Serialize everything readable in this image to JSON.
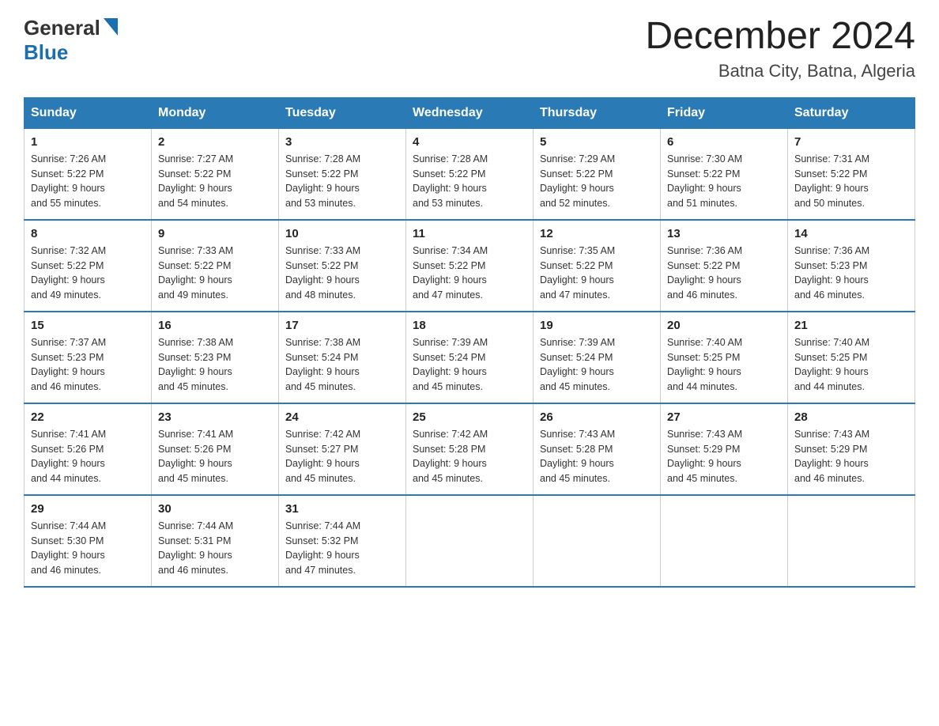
{
  "header": {
    "logo_general": "General",
    "logo_blue": "Blue",
    "month_title": "December 2024",
    "location": "Batna City, Batna, Algeria"
  },
  "days_header": [
    "Sunday",
    "Monday",
    "Tuesday",
    "Wednesday",
    "Thursday",
    "Friday",
    "Saturday"
  ],
  "weeks": [
    [
      {
        "day": "1",
        "sunrise": "7:26 AM",
        "sunset": "5:22 PM",
        "daylight": "9 hours and 55 minutes."
      },
      {
        "day": "2",
        "sunrise": "7:27 AM",
        "sunset": "5:22 PM",
        "daylight": "9 hours and 54 minutes."
      },
      {
        "day": "3",
        "sunrise": "7:28 AM",
        "sunset": "5:22 PM",
        "daylight": "9 hours and 53 minutes."
      },
      {
        "day": "4",
        "sunrise": "7:28 AM",
        "sunset": "5:22 PM",
        "daylight": "9 hours and 53 minutes."
      },
      {
        "day": "5",
        "sunrise": "7:29 AM",
        "sunset": "5:22 PM",
        "daylight": "9 hours and 52 minutes."
      },
      {
        "day": "6",
        "sunrise": "7:30 AM",
        "sunset": "5:22 PM",
        "daylight": "9 hours and 51 minutes."
      },
      {
        "day": "7",
        "sunrise": "7:31 AM",
        "sunset": "5:22 PM",
        "daylight": "9 hours and 50 minutes."
      }
    ],
    [
      {
        "day": "8",
        "sunrise": "7:32 AM",
        "sunset": "5:22 PM",
        "daylight": "9 hours and 49 minutes."
      },
      {
        "day": "9",
        "sunrise": "7:33 AM",
        "sunset": "5:22 PM",
        "daylight": "9 hours and 49 minutes."
      },
      {
        "day": "10",
        "sunrise": "7:33 AM",
        "sunset": "5:22 PM",
        "daylight": "9 hours and 48 minutes."
      },
      {
        "day": "11",
        "sunrise": "7:34 AM",
        "sunset": "5:22 PM",
        "daylight": "9 hours and 47 minutes."
      },
      {
        "day": "12",
        "sunrise": "7:35 AM",
        "sunset": "5:22 PM",
        "daylight": "9 hours and 47 minutes."
      },
      {
        "day": "13",
        "sunrise": "7:36 AM",
        "sunset": "5:22 PM",
        "daylight": "9 hours and 46 minutes."
      },
      {
        "day": "14",
        "sunrise": "7:36 AM",
        "sunset": "5:23 PM",
        "daylight": "9 hours and 46 minutes."
      }
    ],
    [
      {
        "day": "15",
        "sunrise": "7:37 AM",
        "sunset": "5:23 PM",
        "daylight": "9 hours and 46 minutes."
      },
      {
        "day": "16",
        "sunrise": "7:38 AM",
        "sunset": "5:23 PM",
        "daylight": "9 hours and 45 minutes."
      },
      {
        "day": "17",
        "sunrise": "7:38 AM",
        "sunset": "5:24 PM",
        "daylight": "9 hours and 45 minutes."
      },
      {
        "day": "18",
        "sunrise": "7:39 AM",
        "sunset": "5:24 PM",
        "daylight": "9 hours and 45 minutes."
      },
      {
        "day": "19",
        "sunrise": "7:39 AM",
        "sunset": "5:24 PM",
        "daylight": "9 hours and 45 minutes."
      },
      {
        "day": "20",
        "sunrise": "7:40 AM",
        "sunset": "5:25 PM",
        "daylight": "9 hours and 44 minutes."
      },
      {
        "day": "21",
        "sunrise": "7:40 AM",
        "sunset": "5:25 PM",
        "daylight": "9 hours and 44 minutes."
      }
    ],
    [
      {
        "day": "22",
        "sunrise": "7:41 AM",
        "sunset": "5:26 PM",
        "daylight": "9 hours and 44 minutes."
      },
      {
        "day": "23",
        "sunrise": "7:41 AM",
        "sunset": "5:26 PM",
        "daylight": "9 hours and 45 minutes."
      },
      {
        "day": "24",
        "sunrise": "7:42 AM",
        "sunset": "5:27 PM",
        "daylight": "9 hours and 45 minutes."
      },
      {
        "day": "25",
        "sunrise": "7:42 AM",
        "sunset": "5:28 PM",
        "daylight": "9 hours and 45 minutes."
      },
      {
        "day": "26",
        "sunrise": "7:43 AM",
        "sunset": "5:28 PM",
        "daylight": "9 hours and 45 minutes."
      },
      {
        "day": "27",
        "sunrise": "7:43 AM",
        "sunset": "5:29 PM",
        "daylight": "9 hours and 45 minutes."
      },
      {
        "day": "28",
        "sunrise": "7:43 AM",
        "sunset": "5:29 PM",
        "daylight": "9 hours and 46 minutes."
      }
    ],
    [
      {
        "day": "29",
        "sunrise": "7:44 AM",
        "sunset": "5:30 PM",
        "daylight": "9 hours and 46 minutes."
      },
      {
        "day": "30",
        "sunrise": "7:44 AM",
        "sunset": "5:31 PM",
        "daylight": "9 hours and 46 minutes."
      },
      {
        "day": "31",
        "sunrise": "7:44 AM",
        "sunset": "5:32 PM",
        "daylight": "9 hours and 47 minutes."
      },
      null,
      null,
      null,
      null
    ]
  ],
  "labels": {
    "sunrise": "Sunrise:",
    "sunset": "Sunset:",
    "daylight": "Daylight:"
  }
}
